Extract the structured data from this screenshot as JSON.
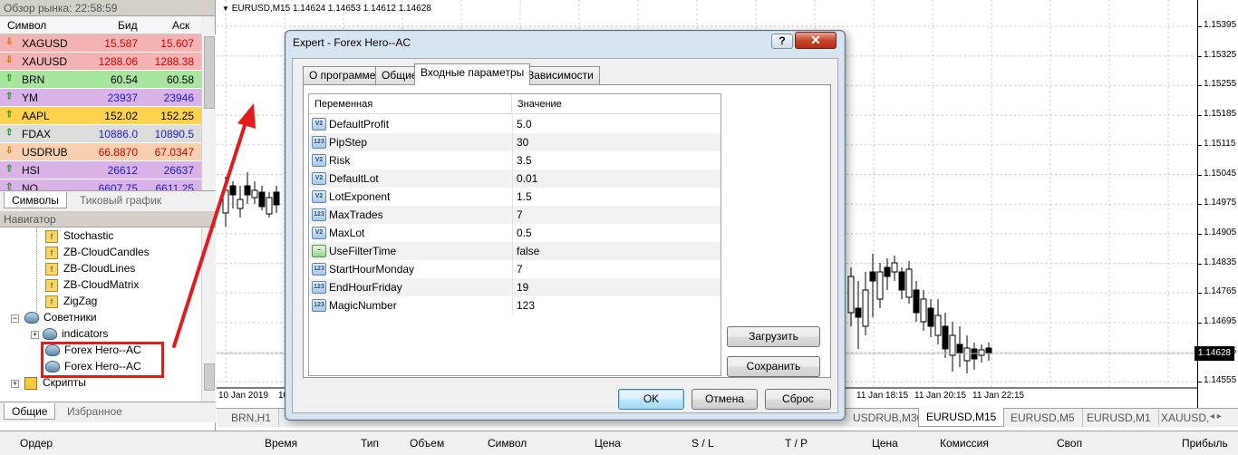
{
  "market_watch": {
    "title": "Обзор рынка: 22:58:59",
    "col_symbol": "Символ",
    "col_bid": "Бид",
    "col_ask": "Аск",
    "rows": [
      {
        "symbol": "XAGUSD",
        "bid": "15.587",
        "ask": "15.607",
        "dir": "down",
        "bg": "#f4b3b3",
        "color": "#d40000"
      },
      {
        "symbol": "XAUUSD",
        "bid": "1288.06",
        "ask": "1288.38",
        "dir": "down",
        "bg": "#f4b3b3",
        "color": "#d40000"
      },
      {
        "symbol": "BRN",
        "bid": "60.54",
        "ask": "60.58",
        "dir": "up",
        "bg": "#a8e6a0",
        "color": "#000000"
      },
      {
        "symbol": "YM",
        "bid": "23937",
        "ask": "23946",
        "dir": "up",
        "bg": "#d9b3e8",
        "color": "#1a1ad4"
      },
      {
        "symbol": "AAPL",
        "bid": "152.02",
        "ask": "152.25",
        "dir": "up",
        "bg": "#ffd24d",
        "color": "#000000"
      },
      {
        "symbol": "FDAX",
        "bid": "10886.0",
        "ask": "10890.5",
        "dir": "up",
        "bg": "#dcdcdc",
        "color": "#1a1ad4"
      },
      {
        "symbol": "USDRUB",
        "bid": "66.8870",
        "ask": "67.0347",
        "dir": "down",
        "bg": "#f7d0b0",
        "color": "#d40000"
      },
      {
        "symbol": "HSI",
        "bid": "26612",
        "ask": "26637",
        "dir": "up",
        "bg": "#d9b3e8",
        "color": "#1a1ad4"
      },
      {
        "symbol": "NQ",
        "bid": "6607.75",
        "ask": "6611.25",
        "dir": "up",
        "bg": "#d9b3e8",
        "color": "#1a1ad4"
      }
    ],
    "tabs": [
      "Символы",
      "Тиковый график"
    ]
  },
  "navigator": {
    "title": "Навигатор",
    "indicators": [
      "Stochastic",
      "ZB-CloudCandles",
      "ZB-CloudLines",
      "ZB-CloudMatrix",
      "ZigZag"
    ],
    "advisors_label": "Советники",
    "indicators_folder": "indicators",
    "experts": [
      "Forex Hero--AC",
      "Forex Hero--AC"
    ],
    "scripts_label": "Скрипты",
    "tabs": [
      "Общие",
      "Избранное"
    ]
  },
  "chart": {
    "title": "EURUSD,M15  1.14624 1.14653 1.14612 1.14628",
    "price_labels": [
      "1.15395",
      "1.15325",
      "1.15255",
      "1.15185",
      "1.15115",
      "1.15045",
      "1.14975",
      "1.14905",
      "1.14835",
      "1.14765",
      "1.14695",
      "1.14625",
      "1.14555"
    ],
    "current_price": "1.14628",
    "time_labels_left": [
      "10 Jan 2019",
      "10"
    ],
    "time_labels_right": [
      "11 Jan 18:15",
      "11 Jan 20:15",
      "11 Jan 22:15"
    ],
    "tabs": [
      "BRN,H1",
      "USDRUB,M30",
      "EURUSD,M15",
      "EURUSD,M5",
      "EURUSD,M1",
      "XAUUSD,"
    ]
  },
  "terminal": {
    "columns": [
      "Ордер",
      "Время",
      "Тип",
      "Объем",
      "Символ",
      "Цена",
      "S / L",
      "T / P",
      "Цена",
      "Комиссия",
      "Своп",
      "Прибыль"
    ]
  },
  "dialog": {
    "title": "Expert - Forex Hero--AC",
    "help": "?",
    "close": "✕",
    "tabs": [
      "О программе",
      "Общие",
      "Входные параметры",
      "Зависимости"
    ],
    "col_variable": "Переменная",
    "col_value": "Значение",
    "params": [
      {
        "name": "DefaultProfit",
        "value": "5.0",
        "icon": "V2"
      },
      {
        "name": "PipStep",
        "value": "30",
        "icon": "123"
      },
      {
        "name": "Risk",
        "value": "3.5",
        "icon": "V2"
      },
      {
        "name": "DefaultLot",
        "value": "0.01",
        "icon": "V2"
      },
      {
        "name": "LotExponent",
        "value": "1.5",
        "icon": "V2"
      },
      {
        "name": "MaxTrades",
        "value": "7",
        "icon": "123"
      },
      {
        "name": "MaxLot",
        "value": "0.5",
        "icon": "V2"
      },
      {
        "name": "UseFilterTime",
        "value": "false",
        "icon": "bool"
      },
      {
        "name": "StartHourMonday",
        "value": "7",
        "icon": "123"
      },
      {
        "name": "EndHourFriday",
        "value": "19",
        "icon": "123"
      },
      {
        "name": "MagicNumber",
        "value": "123",
        "icon": "123"
      }
    ],
    "load_button": "Загрузить",
    "save_button": "Сохранить",
    "ok_button": "OK",
    "cancel_button": "Отмена",
    "reset_button": "Сброс"
  },
  "colors": {
    "annotation": "#e31b1b"
  }
}
